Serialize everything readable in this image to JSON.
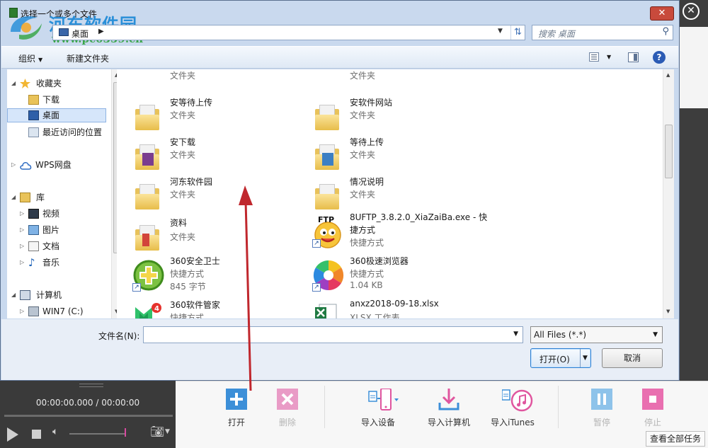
{
  "dialog": {
    "title": "选择一个或多个文件",
    "address": {
      "location": "桌面"
    },
    "search": {
      "placeholder": "搜索 桌面"
    },
    "toolbar": {
      "organize": "组织",
      "new_folder": "新建文件夹",
      "help": "?"
    },
    "nav": [
      {
        "label": "收藏夹",
        "icon": "star-icon",
        "level": 0,
        "expander": "expanded"
      },
      {
        "label": "下载",
        "icon": "download-folder-icon",
        "level": 1
      },
      {
        "label": "桌面",
        "icon": "desktop-icon",
        "level": 1,
        "selected": true
      },
      {
        "label": "最近访问的位置",
        "icon": "recent-places-icon",
        "level": 1
      },
      {
        "label": "WPS网盘",
        "icon": "cloud-icon",
        "level": 0,
        "expander": "collapsed"
      },
      {
        "label": "库",
        "icon": "library-icon",
        "level": 0,
        "expander": "expanded"
      },
      {
        "label": "视频",
        "icon": "video-library-icon",
        "level": 1,
        "expander": "collapsed"
      },
      {
        "label": "图片",
        "icon": "picture-library-icon",
        "level": 1,
        "expander": "collapsed"
      },
      {
        "label": "文档",
        "icon": "document-library-icon",
        "level": 1,
        "expander": "collapsed"
      },
      {
        "label": "音乐",
        "icon": "music-library-icon",
        "level": 1,
        "expander": "collapsed"
      },
      {
        "label": "计算机",
        "icon": "computer-icon",
        "level": 0,
        "expander": "expanded"
      },
      {
        "label": "WIN7 (C:)",
        "icon": "drive-icon",
        "level": 1,
        "expander": "collapsed"
      }
    ],
    "files": [
      {
        "name": "",
        "type": "文件夹",
        "icon": "folder-icon"
      },
      {
        "name": "",
        "type": "文件夹",
        "icon": "folder-icon"
      },
      {
        "name": "安等待上传",
        "type": "文件夹",
        "icon": "folder-icon"
      },
      {
        "name": "安软件网站",
        "type": "文件夹",
        "icon": "folder-icon"
      },
      {
        "name": "安下载",
        "type": "文件夹",
        "icon": "folder-icon"
      },
      {
        "name": "等待上传",
        "type": "文件夹",
        "icon": "folder-icon"
      },
      {
        "name": "河东软件园",
        "type": "文件夹",
        "icon": "folder-icon"
      },
      {
        "name": "情况说明",
        "type": "文件夹",
        "icon": "folder-icon"
      },
      {
        "name": "资料",
        "type": "文件夹",
        "icon": "folder-icon"
      },
      {
        "name": "8UFTP_3.8.2.0_XiaZaiBa.exe - 快",
        "name_line2": "捷方式",
        "type": "快捷方式",
        "icon": "ftp-shortcut-icon",
        "badge": "FTP"
      },
      {
        "name": "360安全卫士",
        "type": "快捷方式",
        "size": "845 字节",
        "icon": "360-safe-icon"
      },
      {
        "name": "360极速浏览器",
        "type": "快捷方式",
        "size": "1.04 KB",
        "icon": "360-browser-icon"
      },
      {
        "name": "360软件管家",
        "type": "快捷方式",
        "icon": "360-software-manager-icon",
        "badge": "4"
      },
      {
        "name": "anxz2018-09-18.xlsx",
        "type": "XLSX 工作表",
        "icon": "excel-file-icon"
      }
    ],
    "filename_label": "文件名(N):",
    "filename_value": "",
    "filter": "All Files (*.*)",
    "open_button": "打开(O)",
    "cancel_button": "取消"
  },
  "watermark": {
    "name": "河东软件园",
    "url": "www.pc0359.cn"
  },
  "player": {
    "time": "00:00:00.000 / 00:00:00"
  },
  "app_toolbar": {
    "tools": [
      {
        "label": "打开",
        "icon": "add-icon",
        "enabled": true
      },
      {
        "label": "删除",
        "icon": "delete-icon",
        "enabled": false
      },
      {
        "label": "导入设备",
        "icon": "import-device-icon",
        "enabled": true
      },
      {
        "label": "导入计算机",
        "icon": "import-computer-icon",
        "enabled": true
      },
      {
        "label": "导入iTunes",
        "icon": "import-itunes-icon",
        "enabled": true
      },
      {
        "label": "暂停",
        "icon": "pause-icon",
        "enabled": false
      },
      {
        "label": "停止",
        "icon": "stop-icon",
        "enabled": false
      }
    ],
    "view_all": "查看全部任务"
  },
  "colors": {
    "accent_blue": "#3c8fd8",
    "accent_pink": "#e0569f",
    "dialog_frame": "#c9d9ee",
    "annotation_arrow": "#c0272d"
  }
}
